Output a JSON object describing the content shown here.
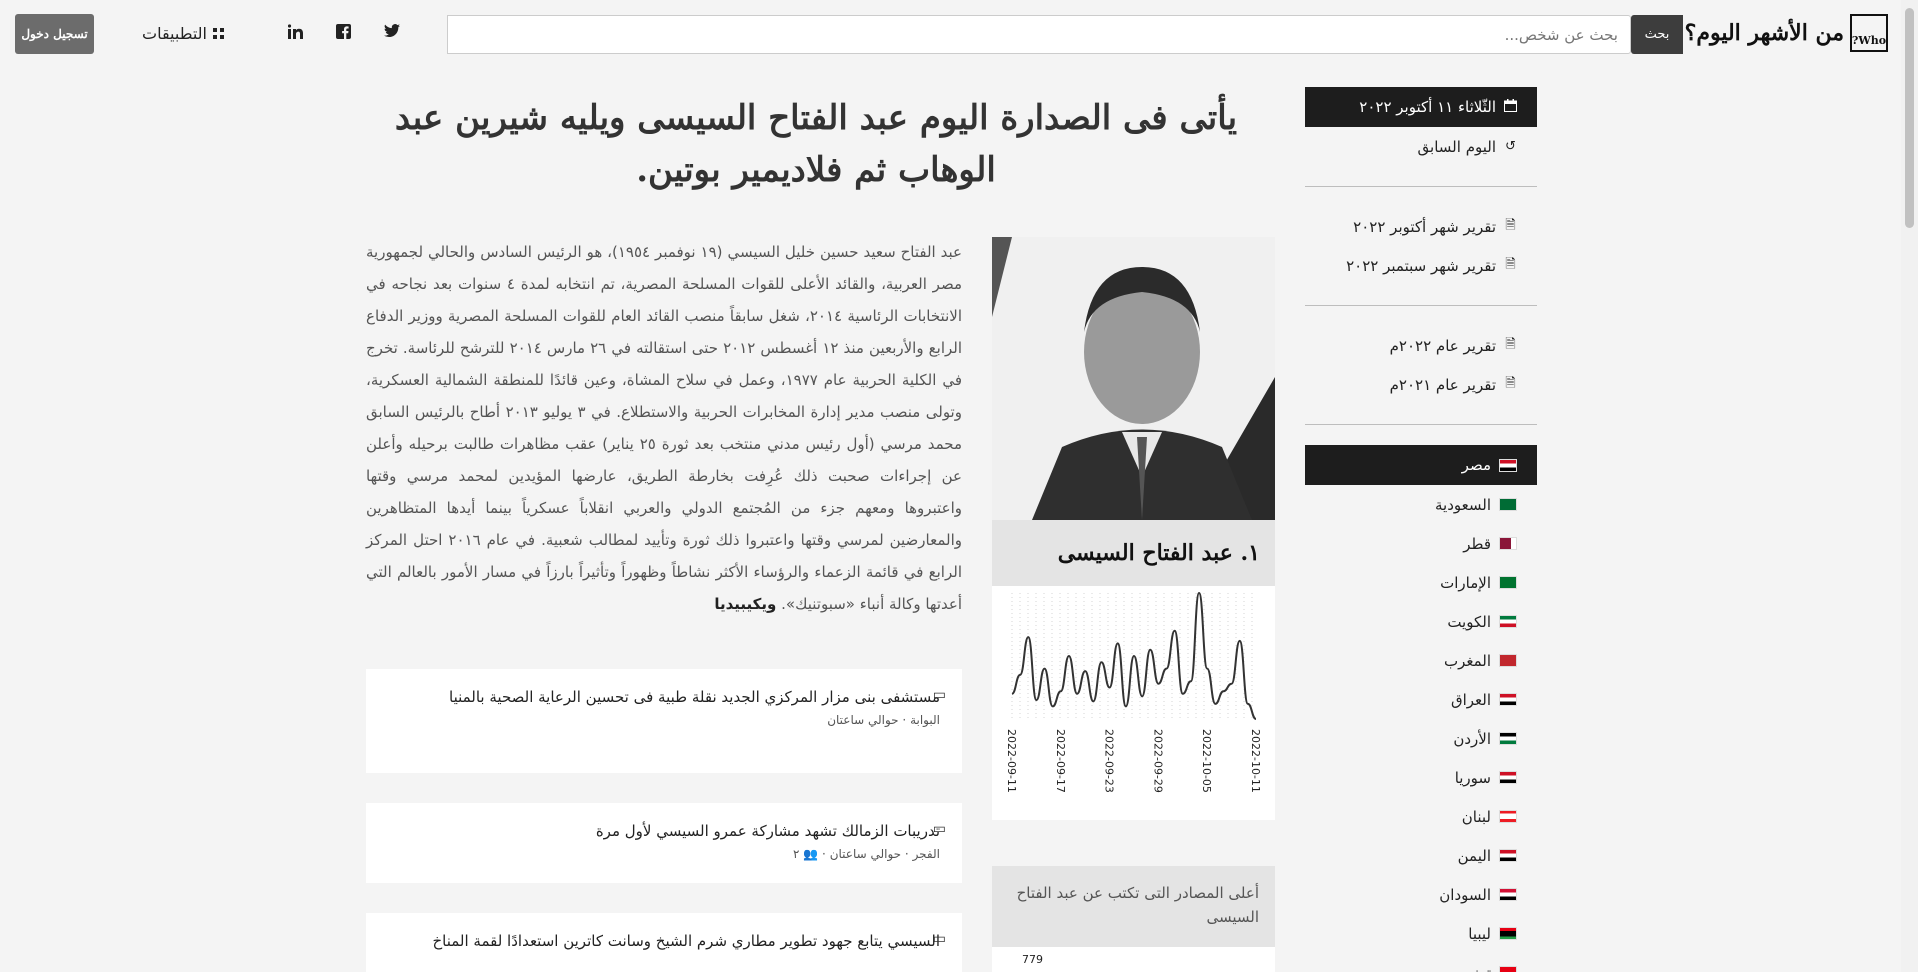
{
  "header": {
    "logo_text": "من الأشهر اليوم؟",
    "logo_badge": "Who?",
    "search_placeholder": "بحث عن شخص...",
    "search_button": "بحث",
    "apps_label": "التطبيقات",
    "login_button": "تسجيل دخول",
    "social": {
      "twitter": "🐦",
      "facebook": "f",
      "linkedin": "in"
    },
    "icons": [
      "twitter-icon",
      "facebook-icon",
      "linkedin-icon",
      "grid-icon"
    ]
  },
  "sidebar": {
    "date_label": "الثّلاثاء ١١ أكتوبر ٢٠٢٢",
    "previous_day": "اليوم السابق",
    "monthly_reports": [
      "تقرير شهر أكتوبر ٢٠٢٢",
      "تقرير شهر سبتمبر ٢٠٢٢"
    ],
    "yearly_reports": [
      "تقرير عام ٢٠٢٢م",
      "تقرير عام ٢٠٢١م"
    ],
    "countries": [
      {
        "name": "مصر",
        "active": true
      },
      {
        "name": "السعودية",
        "active": false
      },
      {
        "name": "قطر",
        "active": false
      },
      {
        "name": "الإمارات",
        "active": false
      },
      {
        "name": "الكويت",
        "active": false
      },
      {
        "name": "المغرب",
        "active": false
      },
      {
        "name": "العراق",
        "active": false
      },
      {
        "name": "الأردن",
        "active": false
      },
      {
        "name": "سوريا",
        "active": false
      },
      {
        "name": "لبنان",
        "active": false
      },
      {
        "name": "اليمن",
        "active": false
      },
      {
        "name": "السودان",
        "active": false
      },
      {
        "name": "ليبيا",
        "active": false
      },
      {
        "name": "تونس",
        "active": false
      }
    ],
    "colors": {
      "active_bg": "#1d1d1d"
    }
  },
  "main": {
    "headline": "يأتى فى الصدارة اليوم عبد الفتاح السيسى ويليه شيرين عبد الوهاب ثم فلاديمير بوتين.",
    "bio": "عبد الفتاح سعيد حسين خليل السيسي (١٩ نوفمبر ١٩٥٤)، هو الرئيس السادس والحالي لجمهورية مصر العربية، والقائد الأعلى للقوات المسلحة المصرية، تم انتخابه لمدة ٤ سنوات بعد نجاحه في الانتخابات الرئاسية ٢٠١٤، شغل سابقاً منصب القائد العام للقوات المسلحة المصرية ووزير الدفاع الرابع والأربعين منذ ١٢ أغسطس ٢٠١٢ حتى استقالته في ٢٦ مارس ٢٠١٤ للترشح للرئاسة. تخرج في الكلية الحربية عام ١٩٧٧، وعمل في سلاح المشاة، وعين قائدًا للمنطقة الشمالية العسكرية، وتولى منصب مدير إدارة المخابرات الحربية والاستطلاع. في ٣ يوليو ٢٠١٣ أطاح بالرئيس السابق محمد مرسي (أول رئيس مدني منتخب بعد ثورة ٢٥ يناير) عقب مظاهرات طالبت برحيله وأعلن عن إجراءات صحبت ذلك عُرِفت بخارطة الطريق، عارضها المؤيدين لمحمد مرسي وقتها واعتبروها ومعهم جزء من المُجتمع الدولي والعربي انقلاباً عسكرياً بينما أيدها المتظاهرين والمعارضين لمرسي وقتها واعتبروا ذلك ثورة وتأييد لمطالب شعبية. في عام ٢٠١٦ احتل المركز الرابع في قائمة الزعماء والرؤساء الأكثر نشاطاً وظهوراً وتأثيراً بارزاً في مسار الأمور بالعالم التي أعدتها وكالة أنباء «سبوتنيك».",
    "bio_source": "ويكيبيديا",
    "news": [
      {
        "title": "مستشفى بنى مزار المركزي الجديد  نقلة طبية فى تحسين الرعاية الصحية بالمنيا",
        "source": "البوابة",
        "time": "حوالي ساعتان",
        "shares": ""
      },
      {
        "title": "تدريبات الزمالك تشهد مشاركة عمرو السيسي لأول مرة",
        "source": "الفجر",
        "time": "حوالي ساعتان",
        "shares": "٢"
      },
      {
        "title": "السيسي يتابع جهود تطوير مطاري شرم الشيخ وسانت كاترين استعدادًا لقمة المناخ",
        "source": "",
        "time": "",
        "shares": ""
      }
    ]
  },
  "profile": {
    "rank_name": "١. عبد الفتاح السيسى",
    "sources_title": "أعلى المصادر التى تكتب عن عبد الفتاح السيسى",
    "sources_top_value": "779"
  },
  "chart_data": {
    "type": "line",
    "x": [
      "2022-09-11",
      "2022-09-12",
      "2022-09-13",
      "2022-09-14",
      "2022-09-15",
      "2022-09-16",
      "2022-09-17",
      "2022-09-18",
      "2022-09-19",
      "2022-09-20",
      "2022-09-21",
      "2022-09-22",
      "2022-09-23",
      "2022-09-24",
      "2022-09-25",
      "2022-09-26",
      "2022-09-27",
      "2022-09-28",
      "2022-09-29",
      "2022-09-30",
      "2022-10-01",
      "2022-10-02",
      "2022-10-03",
      "2022-10-04",
      "2022-10-05",
      "2022-10-06",
      "2022-10-07",
      "2022-10-08",
      "2022-10-09",
      "2022-10-10",
      "2022-10-11"
    ],
    "values": [
      20,
      35,
      65,
      15,
      40,
      10,
      22,
      50,
      20,
      38,
      14,
      45,
      25,
      60,
      10,
      50,
      18,
      55,
      28,
      40,
      70,
      20,
      30,
      100,
      40,
      12,
      22,
      28,
      62,
      12,
      0
    ],
    "tick_labels": [
      "2022-09-11",
      "2022-09-17",
      "2022-09-23",
      "2022-09-29",
      "2022-10-05",
      "2022-10-11"
    ],
    "grid": true,
    "line_color": "#333333"
  }
}
